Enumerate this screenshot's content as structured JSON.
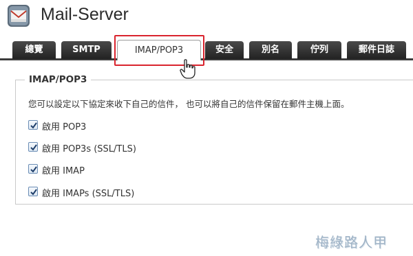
{
  "app": {
    "title": "Mail-Server",
    "icon": "mail-server-icon"
  },
  "tabs": [
    {
      "label": "總覽"
    },
    {
      "label": "SMTP"
    },
    {
      "label": "IMAP/POP3",
      "active": true
    },
    {
      "label": "安全"
    },
    {
      "label": "別名"
    },
    {
      "label": "佇列"
    },
    {
      "label": "郵件日誌"
    }
  ],
  "section": {
    "legend": "IMAP/POP3",
    "description": "您可以設定以下協定來收下自己的信件， 也可以將自己的信件保留在郵件主機上面。",
    "options": [
      {
        "label": "啟用 POP3",
        "checked": true
      },
      {
        "label": "啟用 POP3s (SSL/TLS)",
        "checked": true
      },
      {
        "label": "啟用 IMAP",
        "checked": true
      },
      {
        "label": "啟用 IMAPs (SSL/TLS)",
        "checked": true
      }
    ]
  },
  "watermark": "梅綠路人甲",
  "colors": {
    "highlight": "#d9232d",
    "tab_dark": "#2b2b2b",
    "checkbox_border": "#6b8db5"
  }
}
